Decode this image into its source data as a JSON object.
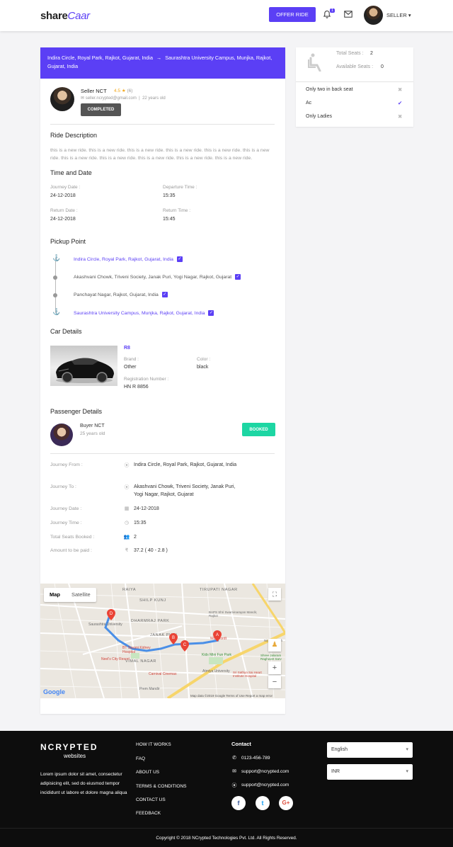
{
  "header": {
    "logo_main": "share",
    "logo_accent": "Caar",
    "offer_ride": "OFFER RIDE",
    "notification_count": "1",
    "user_label": "SELLER"
  },
  "route": {
    "from": "Indira Circle, Royal Park, Rajkot, Gujarat, India",
    "to": "Saurashtra University Campus, Munjka, Rajkot, Gujarat, India"
  },
  "seller": {
    "name": "Seller NCT",
    "rating": "4.5",
    "reviews": "(6)",
    "email": "seller.ncrypted@gmail.com",
    "age": "22 years old",
    "status": "COMPLETED"
  },
  "ride_description": {
    "title": "Ride Description",
    "text": "this is a new ride. this is a new ride. this is a new ride. this is a new ride. this is a new ride. this is a new ride. this is a new ride. this is a new ride. this is a new ride. this is a new ride. this is a new ride."
  },
  "time_date": {
    "title": "Time and Date",
    "journey_date_label": "Journey Date :",
    "journey_date": "24-12-2018",
    "departure_time_label": "Departure Time :",
    "departure_time": "15:35",
    "return_date_label": "Return Date :",
    "return_date": "24-12-2018",
    "return_time_label": "Return Time :",
    "return_time": "15:45"
  },
  "pickup": {
    "title": "Pickup Point",
    "points": [
      "Indira Circle, Royal Park, Rajkot, Gujarat, India",
      "Akashvani Chowk, Triveni Society, Janak Puri, Yogi Nagar, Rajkot, Gujarat",
      "Panchayat Nagar, Rajkot, Gujarat, India",
      "Saurashtra University Campus, Munjka, Rajkot, Gujarat, India"
    ]
  },
  "car": {
    "title": "Car Details",
    "model": "R8",
    "brand_label": "Brand :",
    "brand": "Other",
    "color_label": "Color :",
    "color": "black",
    "reg_label": "Registration Number :",
    "reg": "HN R 8856"
  },
  "passenger": {
    "title": "Passenger Details",
    "name": "Buyer NCT",
    "age": "25 years old",
    "status": "BOOKED",
    "journey_from_label": "Journey From :",
    "journey_from": "Indira Circle, Royal Park, Rajkot, Gujarat, India",
    "journey_to_label": "Journey To :",
    "journey_to": "Akashvani Chowk, Triveni Society, Janak Puri, Yogi Nagar, Rajkot, Gujarat",
    "journey_date_label": "Journey Date :",
    "journey_date": "24-12-2018",
    "journey_time_label": "Journey Time :",
    "journey_time": "15:35",
    "seats_label": "Total Seats Booked :",
    "seats": "2",
    "amount_label": "Amount to be paid :",
    "amount": "37.2 ( 40 - 2.8 )"
  },
  "map": {
    "tab_map": "Map",
    "tab_satellite": "Satellite",
    "google": "Google",
    "footer_text": "Map data ©2019 Google   Terms of Use   Report a map error",
    "labels": [
      "RAIYA",
      "TIRUPATI NAGAR",
      "SHILP KUNJ",
      "DHARMRAJ PARK",
      "VIMAL NAGAR",
      "JANAK PURI",
      "Saurashtra University",
      "BAPS Shri Swaminarayan Mandir, Rajkot",
      "Woodfordt",
      "Kids Mini Fun Park",
      "Atmiya University",
      "Carnival Cinemas",
      "BT Savani Kidney Hospital",
      "Neel's City Resort",
      "Prem Mandir",
      "Nice & Fresh",
      "Shree Jalaram Raghuvet Sarv",
      "Sri Sathya Sai Heart Institute Hospital"
    ],
    "markers": [
      "A",
      "B",
      "C",
      "D"
    ]
  },
  "seats_panel": {
    "total_label": "Total Seats :",
    "total": "2",
    "available_label": "Available Seats :",
    "available": "0",
    "amenities": [
      {
        "label": "Only two in back seat",
        "ok": false
      },
      {
        "label": "Ac",
        "ok": true
      },
      {
        "label": "Only Ladies",
        "ok": false
      }
    ]
  },
  "footer": {
    "logo": "NCRYPTED",
    "logo_sub": "websites",
    "about": "Lorem ipsum dolor sit amet, consectetur adipisicing elit, sed do eiusmod tempor incididunt ut labore et dolore magna aliqua",
    "links": [
      "HOW IT WORKS",
      "FAQ",
      "ABOUT US",
      "TERMS & CONDITIONS",
      "CONTACT US",
      "FEEDBACK"
    ],
    "contact_title": "Contact",
    "phone": "0123-456-789",
    "email1": "support@ncrypted.com",
    "email2": "support@ncrypted.com",
    "language": "English",
    "currency": "INR",
    "copyright": "Copyright © 2018 NCrypted Technologies Pvt. Ltd. All Rights Reserved."
  },
  "colors": {
    "accent": "#5b3ff5",
    "booked": "#1dd6a3",
    "footer": "#0d0d0d"
  }
}
